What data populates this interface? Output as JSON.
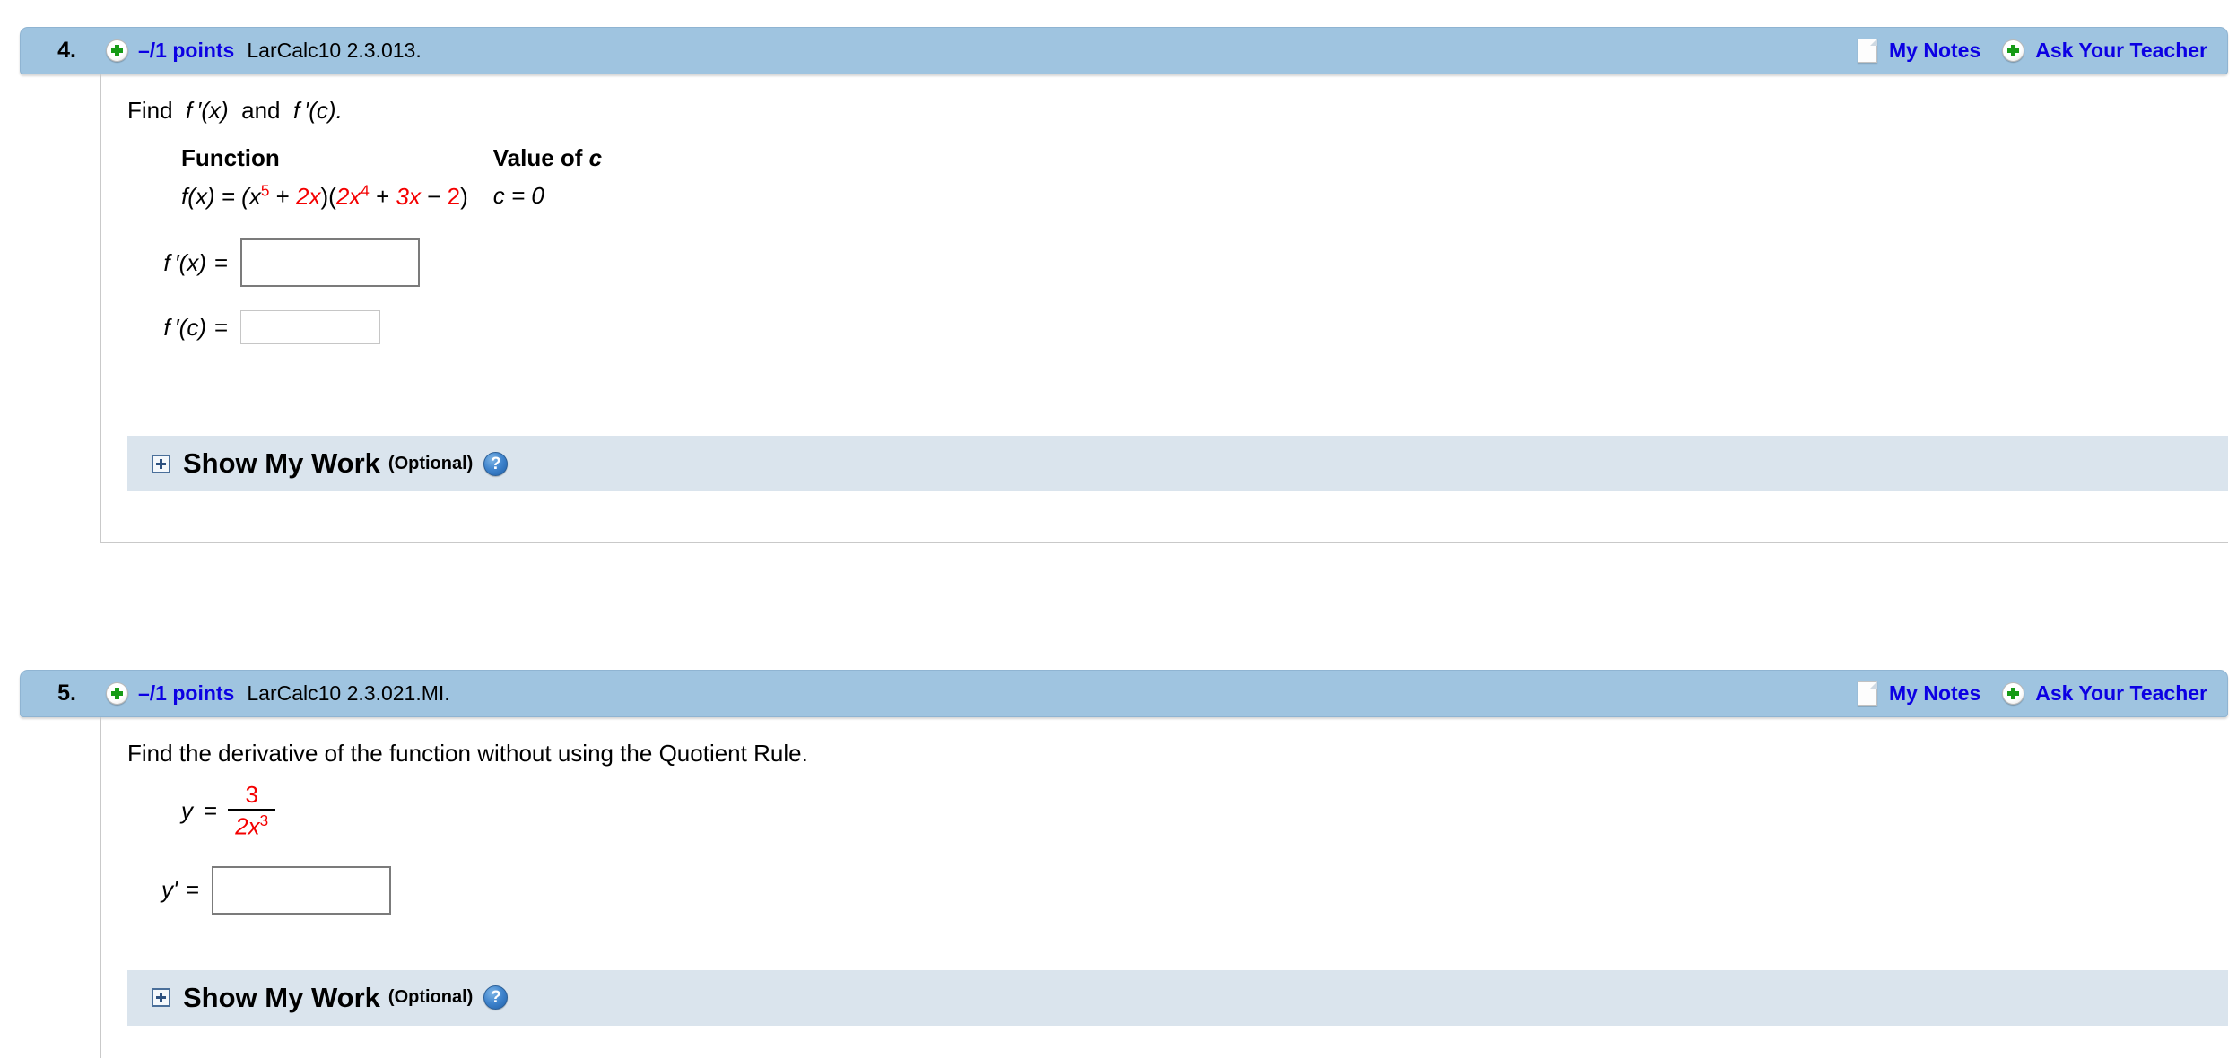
{
  "questions": [
    {
      "number": "4.",
      "points": "–/1 points",
      "code": "LarCalc10 2.3.013.",
      "my_notes": "My Notes",
      "ask_teacher": "Ask Your Teacher",
      "prompt_parts": {
        "find": "Find",
        "fprime_x": "f ′(x)",
        "and": "and",
        "fprime_c": "f ′(c)."
      },
      "table": {
        "header_function": "Function",
        "header_value_of": "Value of",
        "header_value_var": "c",
        "function_expr": {
          "lhs": "f(x) = (",
          "x": "x",
          "exp1": "5",
          "plus1": " + ",
          "term2": "2x",
          "mid": ")(",
          "term3": "2x",
          "exp2": "4",
          "plus2": " + ",
          "term4": "3x",
          "minus": " − ",
          "term5": "2",
          "close": ")"
        },
        "value_expr": "c = 0"
      },
      "answers": [
        {
          "label": "f ′(x)",
          "equals": "=",
          "value": "",
          "placeholder": "",
          "size": "large"
        },
        {
          "label": "f ′(c)",
          "equals": "=",
          "value": "",
          "placeholder": "",
          "size": "small"
        }
      ],
      "show_my_work": {
        "title": "Show My Work",
        "optional": "(Optional)",
        "help": "?"
      }
    },
    {
      "number": "5.",
      "points": "–/1 points",
      "code": "LarCalc10 2.3.021.MI.",
      "my_notes": "My Notes",
      "ask_teacher": "Ask Your Teacher",
      "prompt": "Find the derivative of the function without using the Quotient Rule.",
      "equation": {
        "lhs": "y",
        "equals": "=",
        "numerator": "3",
        "denominator_base": "2x",
        "denominator_exp": "3"
      },
      "answers": [
        {
          "label": "y'",
          "equals": "=",
          "value": "",
          "placeholder": "",
          "size": "large"
        }
      ],
      "show_my_work": {
        "title": "Show My Work",
        "optional": "(Optional)",
        "help": "?"
      }
    }
  ],
  "colors": {
    "header_blue": "#9fc4e0",
    "band_blue": "#dae4ed",
    "link_blue": "#0c00e3",
    "math_red": "#f40000",
    "plus_green": "#179b17"
  }
}
